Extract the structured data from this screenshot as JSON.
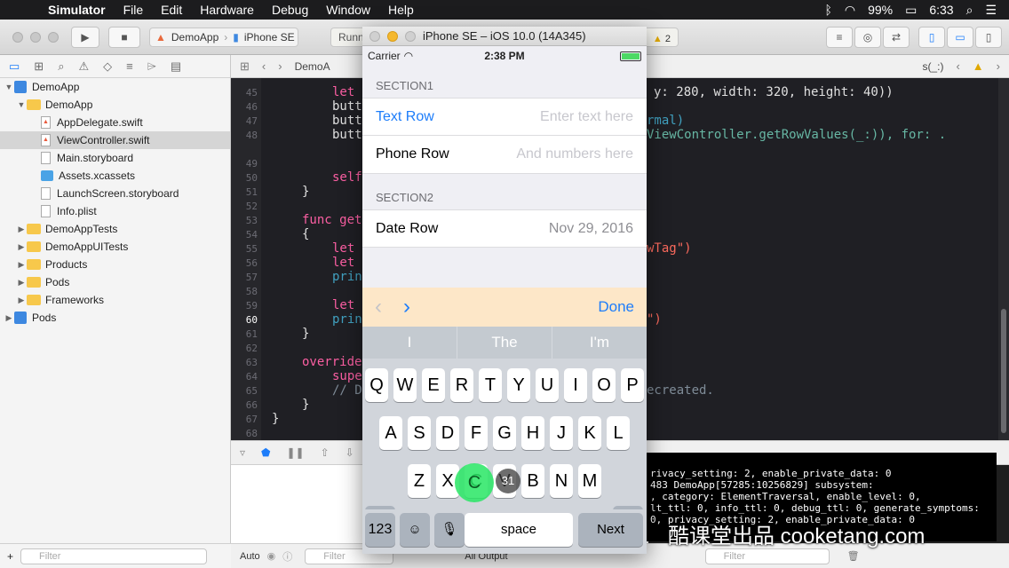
{
  "menubar": {
    "app_name": "Simulator",
    "items": [
      "File",
      "Edit",
      "Hardware",
      "Debug",
      "Window",
      "Help"
    ],
    "battery": "99%",
    "time": "6:33"
  },
  "toolbar": {
    "scheme_app": "DemoApp",
    "scheme_device": "iPhone SE",
    "activity_text": "Runni",
    "warning_count": "2"
  },
  "navigator": {
    "items": [
      {
        "label": "DemoApp",
        "kind": "project",
        "level": 0,
        "open": true
      },
      {
        "label": "DemoApp",
        "kind": "folder",
        "level": 1,
        "open": true
      },
      {
        "label": "AppDelegate.swift",
        "kind": "swift",
        "level": 2
      },
      {
        "label": "ViewController.swift",
        "kind": "swift",
        "level": 2,
        "selected": true
      },
      {
        "label": "Main.storyboard",
        "kind": "file",
        "level": 2
      },
      {
        "label": "Assets.xcassets",
        "kind": "assets",
        "level": 2
      },
      {
        "label": "LaunchScreen.storyboard",
        "kind": "file",
        "level": 2
      },
      {
        "label": "Info.plist",
        "kind": "file",
        "level": 2
      },
      {
        "label": "DemoAppTests",
        "kind": "folder",
        "level": 1
      },
      {
        "label": "DemoAppUITests",
        "kind": "folder",
        "level": 1
      },
      {
        "label": "Products",
        "kind": "folder",
        "level": 1
      },
      {
        "label": "Pods",
        "kind": "folder",
        "level": 1
      },
      {
        "label": "Frameworks",
        "kind": "folder",
        "level": 1
      },
      {
        "label": "Pods",
        "kind": "project",
        "level": 0
      }
    ],
    "filter_placeholder": "Filter"
  },
  "editor": {
    "jumpbar_file": "DemoA",
    "jumpbar_tail": "s(_:)",
    "line_numbers": [
      "45",
      "46",
      "47",
      "48",
      "",
      "49",
      "50",
      "51",
      "52",
      "53",
      "54",
      "55",
      "56",
      "57",
      "58",
      "59",
      "60",
      "61",
      "62",
      "63",
      "64",
      "65",
      "66",
      "67",
      "68"
    ],
    "current_line": "60",
    "code": {
      "l45": "let",
      "l45r": "y: 280, width: 320, height: 40))",
      "l46": "butt",
      "l47": "butt",
      "l47r": "rmal)",
      "l48": "butt",
      "l48r": "ViewController.getRowValues(_:)), for: .",
      "l50": "self",
      "l51": "}",
      "l53": "func get",
      "l54": "{",
      "l55": "let",
      "l55r": "wTag\")",
      "l56": "let",
      "l57": "prin",
      "l59": "let",
      "l60": "prin",
      "l60r": "\")",
      "l61": "}",
      "l63": "override",
      "l64": "supe",
      "l65": "// D",
      "l65r": "ecreated.",
      "l66": "}",
      "l67": "}"
    }
  },
  "debug": {
    "auto_label": "Auto",
    "output_label": "All Output",
    "filter_placeholder": "Filter",
    "console_lines": [
      "rivacy_setting: 2, enable_private_data: 0",
      "483 DemoApp[57285:10256829] subsystem:",
      ", category: ElementTraversal, enable_level: 0,",
      "lt_ttl: 0, info_ttl: 0, debug_ttl: 0, generate_symptoms:",
      "0, privacy_setting: 2, enable_private_data: 0"
    ]
  },
  "simulator": {
    "title": "iPhone SE – iOS 10.0 (14A345)",
    "carrier": "Carrier",
    "time": "2:38 PM",
    "battery_level": 1.0,
    "section1": "SECTION1",
    "section2": "SECTION2",
    "rows": {
      "text_label": "Text Row",
      "text_placeholder": "Enter text here",
      "phone_label": "Phone Row",
      "phone_placeholder": "And numbers here",
      "date_label": "Date Row",
      "date_value": "Nov 29, 2016"
    },
    "accessory": {
      "prev": "‹",
      "next": "›",
      "done": "Done"
    },
    "suggestions": [
      "I",
      "The",
      "I'm"
    ],
    "keys": {
      "row1": [
        "Q",
        "W",
        "E",
        "R",
        "T",
        "Y",
        "U",
        "I",
        "O",
        "P"
      ],
      "row2": [
        "A",
        "S",
        "D",
        "F",
        "G",
        "H",
        "J",
        "K",
        "L"
      ],
      "row3": [
        "Z",
        "X",
        "C",
        "V",
        "B",
        "N",
        "M"
      ],
      "numbers": "123",
      "space": "space",
      "next": "Next"
    },
    "touch_letter": "C",
    "touch_badge": "31"
  },
  "watermark": "酷课堂出品 cooketang.com",
  "colors": {
    "accent": "#1d7dfa",
    "touch": "#28e664",
    "accessory_bg": "#fde7c8"
  }
}
